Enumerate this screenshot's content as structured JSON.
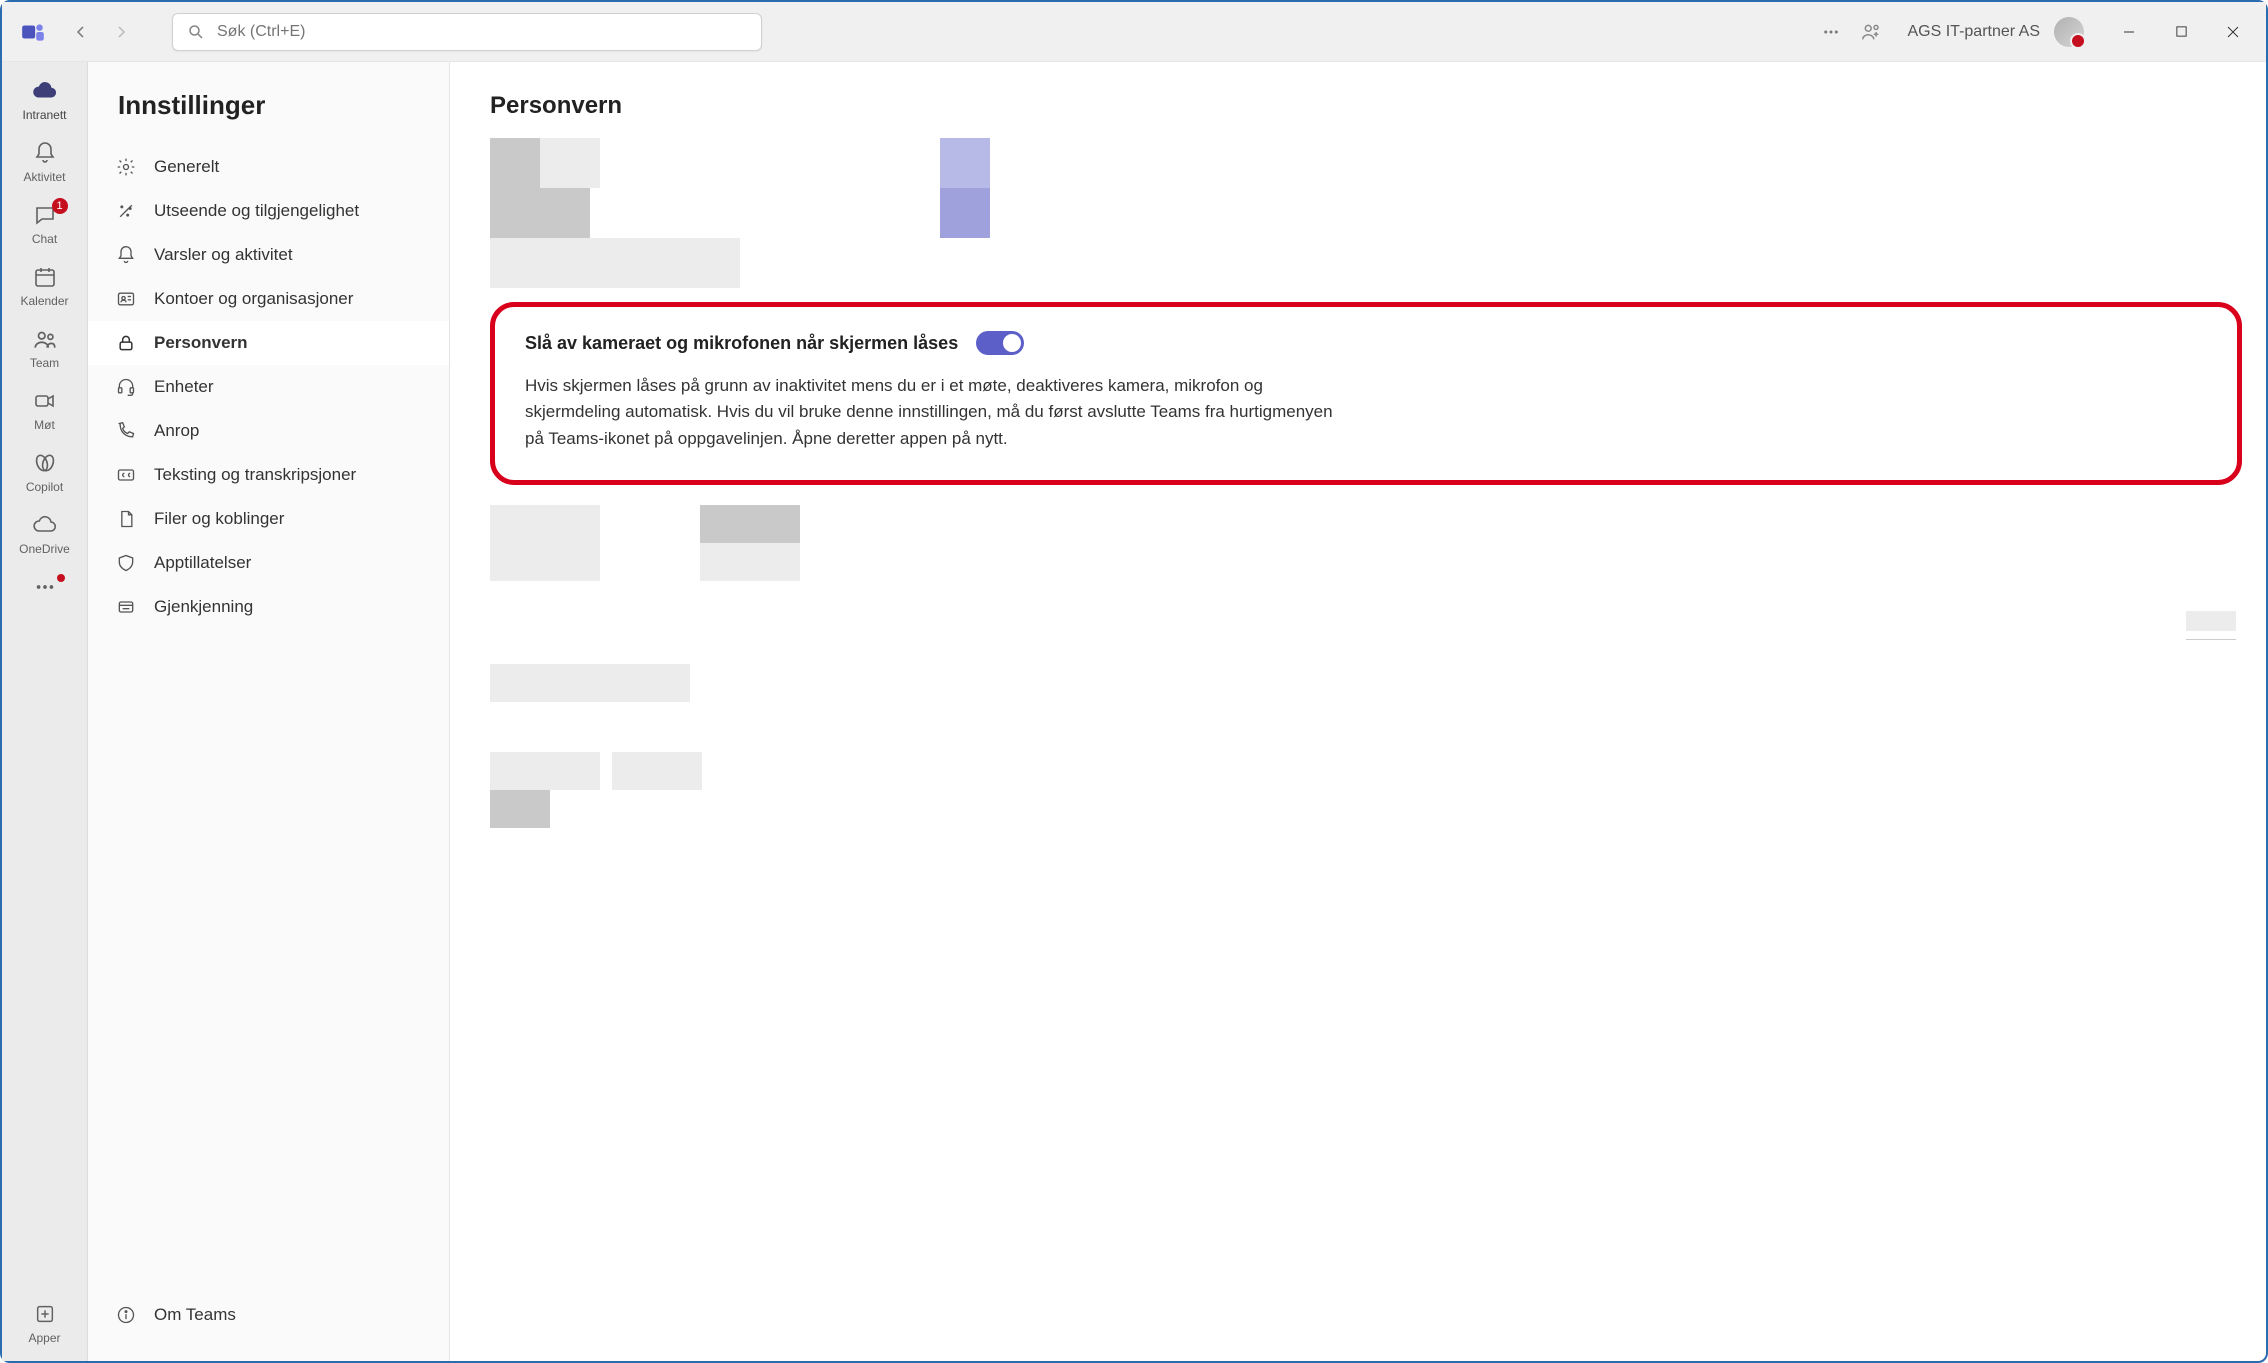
{
  "titlebar": {
    "search_placeholder": "Søk (Ctrl+E)",
    "org_name": "AGS IT-partner AS"
  },
  "rail": {
    "items": [
      {
        "id": "intranett",
        "label": "Intranett",
        "icon": "cloud-icon",
        "active": true
      },
      {
        "id": "aktivitet",
        "label": "Aktivitet",
        "icon": "bell-icon"
      },
      {
        "id": "chat",
        "label": "Chat",
        "icon": "chat-icon",
        "badge": "1"
      },
      {
        "id": "kalender",
        "label": "Kalender",
        "icon": "calendar-icon"
      },
      {
        "id": "team",
        "label": "Team",
        "icon": "people-icon"
      },
      {
        "id": "mot",
        "label": "Møt",
        "icon": "video-icon"
      },
      {
        "id": "copilot",
        "label": "Copilot",
        "icon": "copilot-icon"
      },
      {
        "id": "onedrive",
        "label": "OneDrive",
        "icon": "cloud-outline-icon"
      },
      {
        "id": "more",
        "label": "",
        "icon": "more-icon",
        "dot": true
      }
    ],
    "apper_label": "Apper"
  },
  "settings": {
    "title": "Innstillinger",
    "items": [
      {
        "id": "generelt",
        "label": "Generelt",
        "icon": "gear-icon"
      },
      {
        "id": "utseende",
        "label": "Utseende og tilgjengelighet",
        "icon": "wand-icon"
      },
      {
        "id": "varsler",
        "label": "Varsler og aktivitet",
        "icon": "bell-icon"
      },
      {
        "id": "kontoer",
        "label": "Kontoer og organisasjoner",
        "icon": "id-card-icon"
      },
      {
        "id": "personvern",
        "label": "Personvern",
        "icon": "lock-icon",
        "selected": true
      },
      {
        "id": "enheter",
        "label": "Enheter",
        "icon": "headset-icon"
      },
      {
        "id": "anrop",
        "label": "Anrop",
        "icon": "phone-icon"
      },
      {
        "id": "teksting",
        "label": "Teksting og transkripsjoner",
        "icon": "cc-icon"
      },
      {
        "id": "filer",
        "label": "Filer og koblinger",
        "icon": "file-icon"
      },
      {
        "id": "apptill",
        "label": "Apptillatelser",
        "icon": "shield-icon"
      },
      {
        "id": "gjenkjenning",
        "label": "Gjenkjenning",
        "icon": "recognition-icon"
      }
    ],
    "about": {
      "label": "Om Teams",
      "icon": "info-icon"
    }
  },
  "content": {
    "title": "Personvern",
    "highlighted_setting": {
      "label": "Slå av kameraet og mikrofonen når skjermen låses",
      "description": "Hvis skjermen låses på grunn av inaktivitet mens du er i et møte, deaktiveres kamera, mikrofon og skjermdeling automatisk. Hvis du vil bruke denne innstillingen, må du først avslutte Teams fra hurtigmenyen på Teams-ikonet på oppgavelinjen. Åpne deretter appen på nytt.",
      "toggle_on": true
    }
  }
}
